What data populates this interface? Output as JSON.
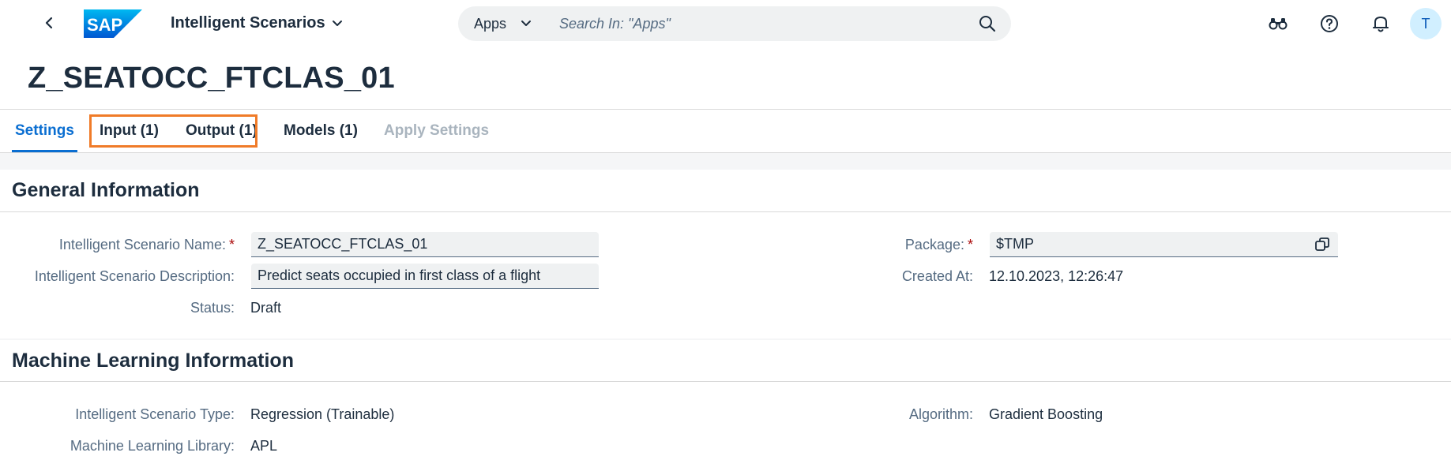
{
  "shell": {
    "app_title": "Intelligent Scenarios",
    "search_scope": "Apps",
    "search_placeholder": "Search In: \"Apps\"",
    "avatar_initial": "T",
    "icons": [
      "back-icon",
      "sap-logo",
      "chevron-down-icon",
      "search-icon",
      "binoculars-icon",
      "help-icon",
      "notification-bell-icon"
    ]
  },
  "page": {
    "title": "Z_SEATOCC_FTCLAS_01"
  },
  "tabs": [
    {
      "label": "Settings",
      "state": "active"
    },
    {
      "label": "Input (1)",
      "state": "normal"
    },
    {
      "label": "Output (1)",
      "state": "normal"
    },
    {
      "label": "Models (1)",
      "state": "normal"
    },
    {
      "label": "Apply Settings",
      "state": "disabled"
    }
  ],
  "general": {
    "title": "General Information",
    "name_label": "Intelligent Scenario Name:",
    "name_value": "Z_SEATOCC_FTCLAS_01",
    "description_label": "Intelligent Scenario Description:",
    "description_value": "Predict seats occupied in first class of a flight",
    "status_label": "Status:",
    "status_value": "Draft",
    "package_label": "Package:",
    "package_value": "$TMP",
    "created_label": "Created At:",
    "created_value": "12.10.2023, 12:26:47",
    "required_marker": "*"
  },
  "ml": {
    "title": "Machine Learning Information",
    "type_label": "Intelligent Scenario Type:",
    "type_value": "Regression (Trainable)",
    "library_label": "Machine Learning Library:",
    "library_value": "APL",
    "algorithm_label": "Algorithm:",
    "algorithm_value": "Gradient Boosting"
  },
  "colors": {
    "accent": "#0a6ed1",
    "highlight": "#f07b28",
    "required": "#aa0808",
    "sap_blue": "#0070f2"
  }
}
